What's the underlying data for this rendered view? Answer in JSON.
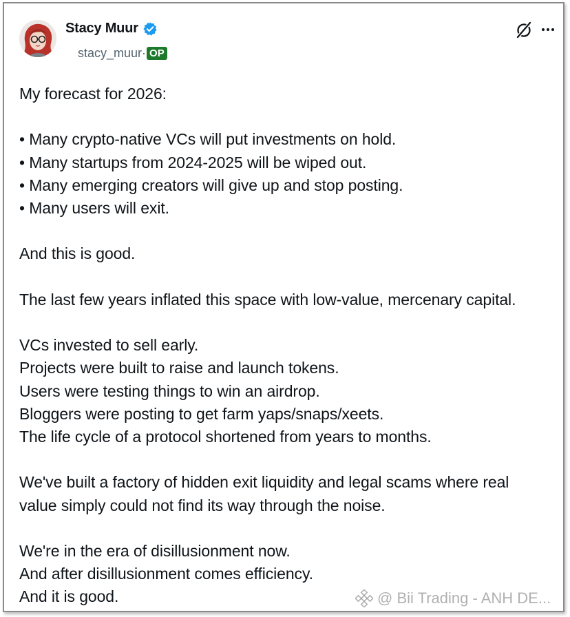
{
  "author": {
    "name": "Stacy Muur",
    "handle": "stacy_muur·",
    "badge": "OP",
    "verified": true,
    "avatar": "avatar-illustration-red-hair"
  },
  "icons": {
    "grok": "grok-icon",
    "more": "more-options-icon",
    "verified": "verified-badge-icon"
  },
  "post": {
    "intro": "My forecast for 2026:",
    "bullets": [
      "• Many crypto-native VCs will put investments on hold.",
      "• Many startups from 2024-2025 will be wiped out.",
      "• Many emerging creators will give up and stop posting.",
      "• Many users will exit."
    ],
    "good": "And this is good.",
    "inflated": "The last few years inflated this space with low-value, mercenary capital.",
    "examples": [
      "VCs invested to sell early.",
      "Projects were built to raise and launch tokens.",
      "Users were testing things to win an airdrop.",
      "Bloggers were posting to get farm yaps/snaps/xeets.",
      "The life cycle of a protocol shortened from years to months."
    ],
    "factory_line1": "We've built a factory of hidden exit liquidity and legal scams where real",
    "factory_line2": "value simply could not find its way through the noise.",
    "closing": [
      "We're in the era of disillusionment now.",
      "And after disillusionment comes efficiency.",
      "And it is good."
    ]
  },
  "watermark": {
    "text": "@ Bii Trading - ANH DE..."
  },
  "colors": {
    "text": "#0f1419",
    "handle": "#536471",
    "verified": "#1d9bf0",
    "op_badge": "#1d7a2a"
  }
}
